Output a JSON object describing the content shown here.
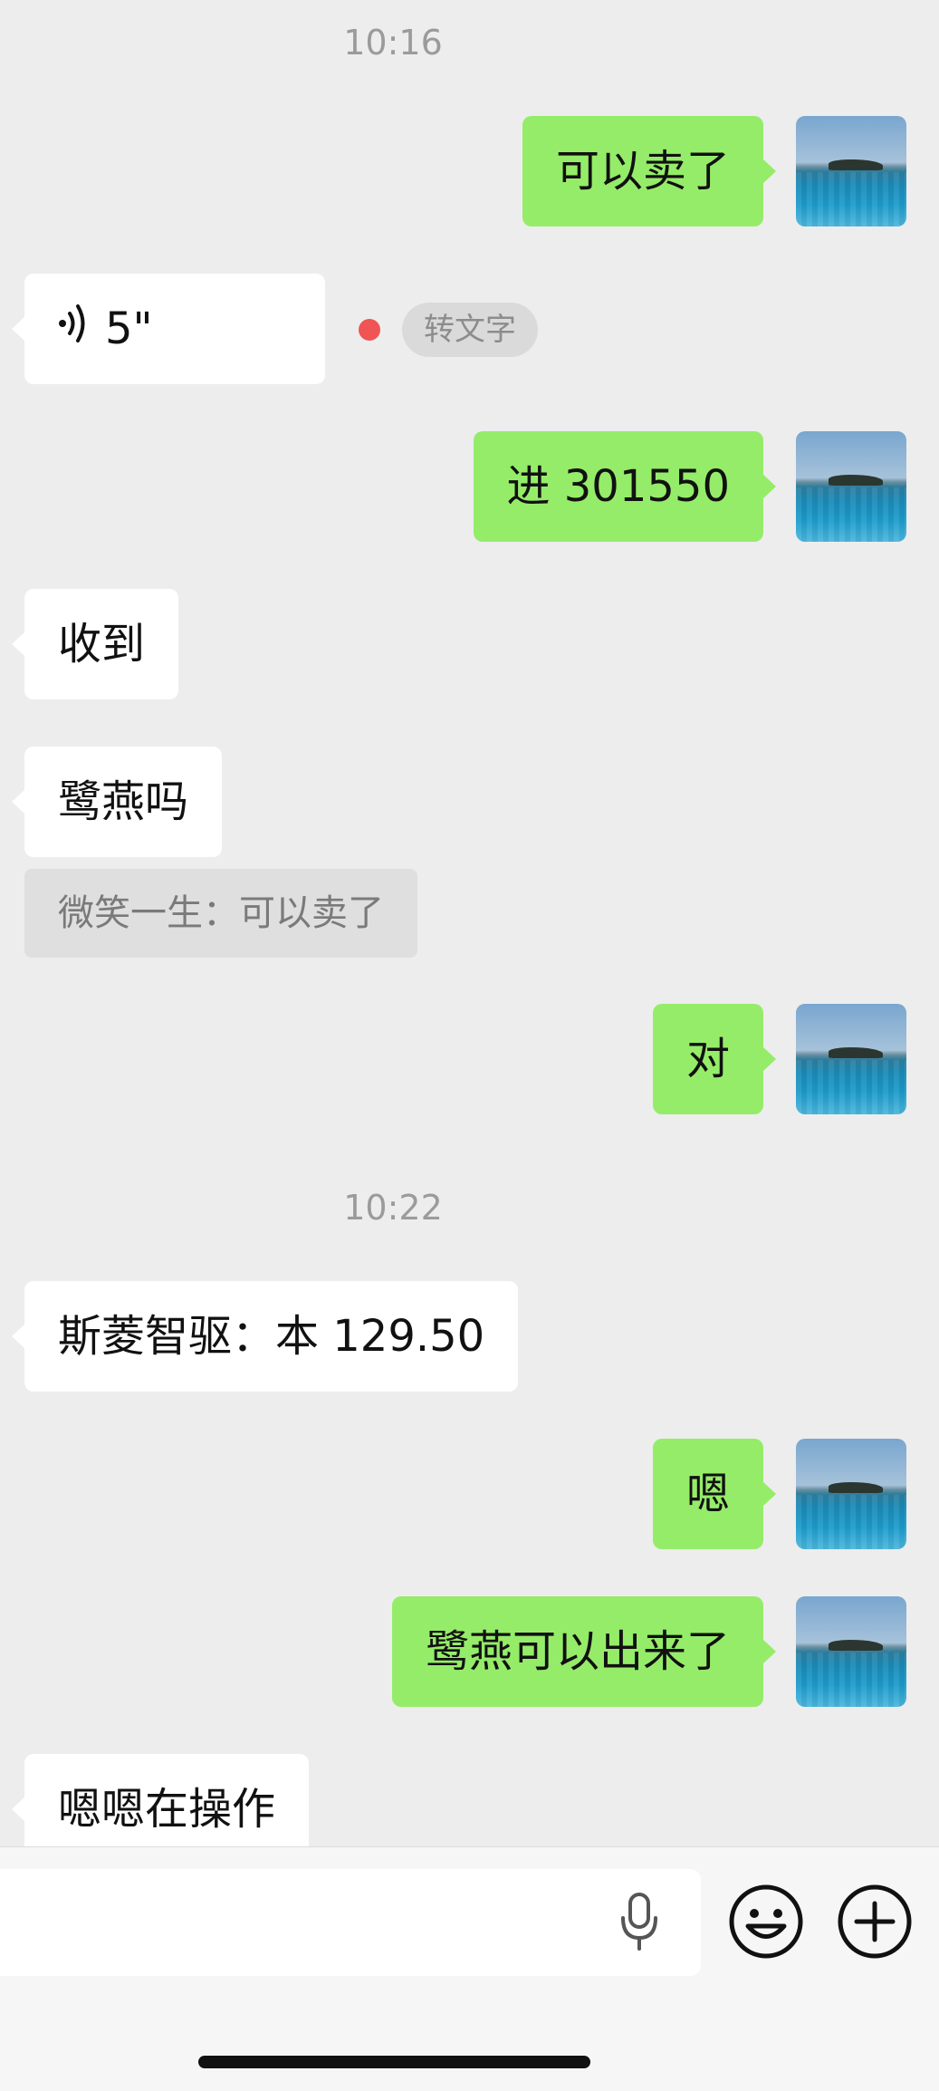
{
  "timestamps": [
    "10:16",
    "10:22"
  ],
  "messages": [
    {
      "from": "me",
      "text": "可以卖了"
    },
    {
      "from": "them",
      "type": "voice",
      "duration": "5\"",
      "transcribe_label": "转文字",
      "unread": true
    },
    {
      "from": "me",
      "text": "进 301550"
    },
    {
      "from": "them",
      "text": "收到"
    },
    {
      "from": "them",
      "text": "鹭燕吗",
      "quote": "微笑一生：可以卖了"
    },
    {
      "from": "me",
      "text": "对"
    },
    {
      "from": "them",
      "text": "斯菱智驱：本 129.50"
    },
    {
      "from": "me",
      "text": "嗯"
    },
    {
      "from": "me",
      "text": "鹭燕可以出来了"
    },
    {
      "from": "them",
      "text": "嗯嗯在操作"
    }
  ],
  "input_bar": {
    "value": "",
    "icons": [
      "microphone-icon",
      "emoji-icon",
      "plus-icon"
    ]
  },
  "colors": {
    "background": "#ededed",
    "my_bubble": "#95ec69",
    "their_bubble": "#ffffff",
    "unread_dot": "#f05454"
  }
}
